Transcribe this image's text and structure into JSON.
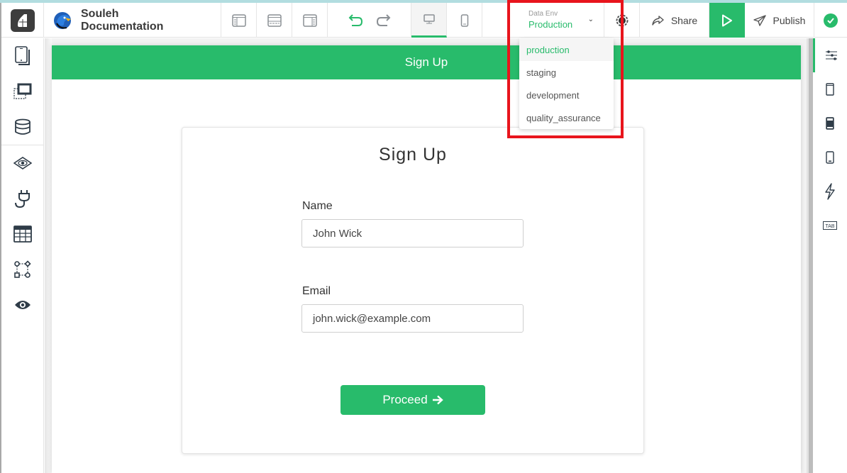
{
  "app": {
    "brand_line1": "Souleh",
    "brand_line2": "Documentation"
  },
  "toolbar": {
    "layout_icons": [
      "layout-left-sidebar-icon",
      "layout-header-footer-icon",
      "layout-right-sidebar-icon"
    ],
    "undo_icon": "undo-icon",
    "redo_icon": "redo-icon",
    "devices": [
      {
        "name": "desktop-icon",
        "active": true
      },
      {
        "name": "mobile-icon",
        "active": false
      }
    ],
    "data_env_label": "Data Env",
    "data_env_value": "Production",
    "share_label": "Share",
    "publish_label": "Publish"
  },
  "data_env_dropdown": {
    "options": [
      "production",
      "staging",
      "development",
      "quality_assurance"
    ],
    "selected": "production"
  },
  "left_sidebar": {
    "items": [
      "pages-icon",
      "components-icon",
      "database-icon",
      "preview-layers-icon",
      "plugins-icon",
      "table-icon",
      "workflow-icon",
      "view-icon"
    ]
  },
  "right_sidebar": {
    "items": [
      "properties-icon",
      "device-tablet-icon",
      "device-filled-icon",
      "device-phone-icon",
      "actions-icon",
      "tab-icon"
    ]
  },
  "page": {
    "header_title": "Sign Up",
    "card_title": "Sign Up",
    "name_label": "Name",
    "name_value": "John Wick",
    "email_label": "Email",
    "email_value": "john.wick@example.com",
    "proceed_label": "Proceed"
  },
  "colors": {
    "accent": "#28bb6b",
    "highlight": "#e8141c"
  }
}
